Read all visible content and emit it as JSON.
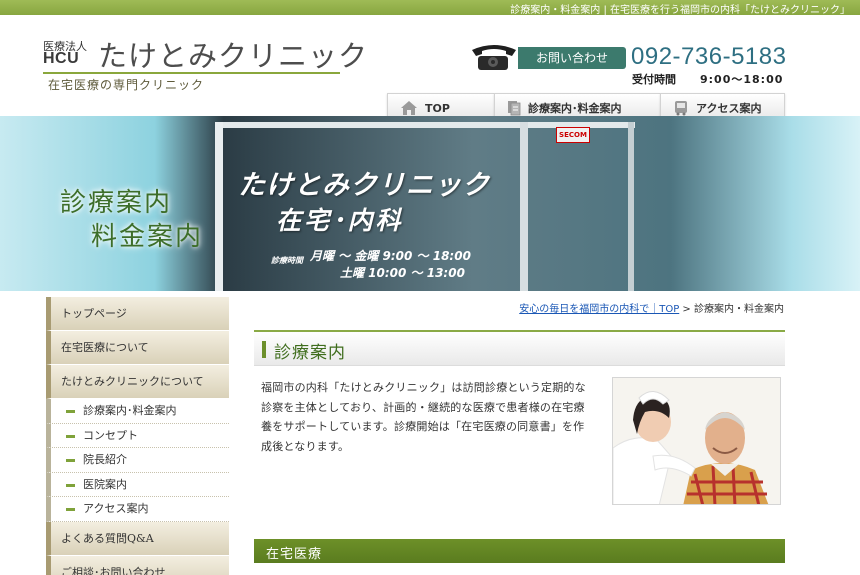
{
  "topbar": {
    "text": "診療案内・料金案内 | 在宅医療を行う福岡市の内科「たけとみクリニック」"
  },
  "logo": {
    "corp": "医療法人",
    "hcu": "HCU",
    "name": "たけとみクリニック",
    "subtitle": "在宅医療の専門クリニック"
  },
  "contact": {
    "label": "お問い合わせ",
    "phone": "092-736-5183",
    "hours_label": "受付時間",
    "hours_value": "9:00〜18:00"
  },
  "gnav": {
    "items": [
      {
        "label": "TOP",
        "icon": "home-icon"
      },
      {
        "label": "診療案内･料金案内",
        "icon": "document-icon"
      },
      {
        "label": "アクセス案内",
        "icon": "bus-icon"
      }
    ]
  },
  "hero": {
    "title_line1": "診療案内",
    "title_line2": "料金案内",
    "glass_name": "たけとみクリニック",
    "glass_dept": "在宅･内科",
    "glass_hours_label": "診療時間",
    "glass_hours_1": "月曜 〜 金曜  9:00 〜 18:00",
    "glass_hours_2": "土曜 10:00 〜 13:00",
    "sign": "SECOM"
  },
  "sidebar": {
    "main_items": [
      {
        "label": "トップページ"
      },
      {
        "label": "在宅医療について"
      },
      {
        "label": "たけとみクリニックについて"
      }
    ],
    "sub_items": [
      {
        "label": "診療案内･料金案内"
      },
      {
        "label": "コンセプト"
      },
      {
        "label": "院長紹介"
      },
      {
        "label": "医院案内"
      },
      {
        "label": "アクセス案内"
      }
    ],
    "more_items": [
      {
        "label": "よくある質問Q&A"
      },
      {
        "label": "ご相談･お問い合わせ"
      }
    ]
  },
  "breadcrumb": {
    "link": "安心の毎日を福岡市の内科で｜TOP",
    "separator": " > ",
    "current": "診療案内・料金案内"
  },
  "content": {
    "heading": "診療案内",
    "intro": "福岡市の内科「たけとみクリニック」は訪問診療という定期的な診察を主体としており、計画的・継続的な医療で患者様の在宅療養をサポートしています。診療開始は「在宅医療の同意書」を作成後となります。",
    "subheading": "在宅医療"
  },
  "colors": {
    "accent_green": "#8aa73c",
    "phone_blue": "#2e6f82",
    "contact_teal": "#3c7a6d",
    "link_blue": "#1a57b5"
  }
}
